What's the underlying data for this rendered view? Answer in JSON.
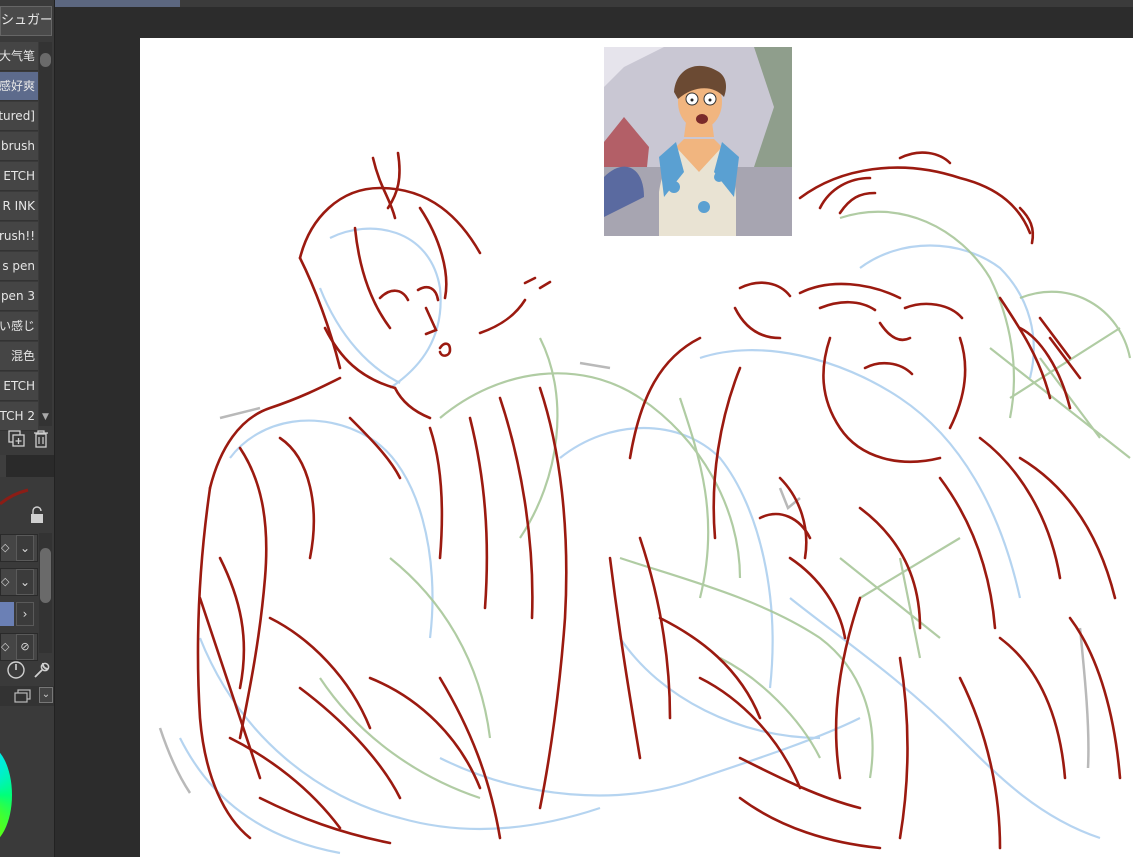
{
  "brush_panel": {
    "header": "シュガー",
    "items": [
      {
        "label": "大气笔",
        "selected": false
      },
      {
        "label": "感好爽",
        "selected": true
      },
      {
        "label": "tured]",
        "selected": false
      },
      {
        "label": "brush",
        "selected": false
      },
      {
        "label": "ETCH",
        "selected": false
      },
      {
        "label": "R INK",
        "selected": false
      },
      {
        "label": "Brush!!",
        "selected": false
      },
      {
        "label": "s pen",
        "selected": false
      },
      {
        "label": "pen 3",
        "selected": false
      },
      {
        "label": "い感じ",
        "selected": false
      },
      {
        "label": "混色",
        "selected": false
      },
      {
        "label": "ETCH",
        "selected": false
      },
      {
        "label": "TCH 2",
        "selected": false
      }
    ]
  },
  "icons": {
    "duplicate": "duplicate-brush-icon",
    "delete": "trash-icon",
    "lock": "lock-icon",
    "pressure": "pressure-dial-icon",
    "settings": "wrench-icon",
    "color_wheel": "color-wheel-icon"
  },
  "colors": {
    "sketch_red": "#9b1a10",
    "sketch_blue": "#a9cdee",
    "sketch_green": "#a8c79a",
    "selected_item": "#5d6b8c"
  }
}
